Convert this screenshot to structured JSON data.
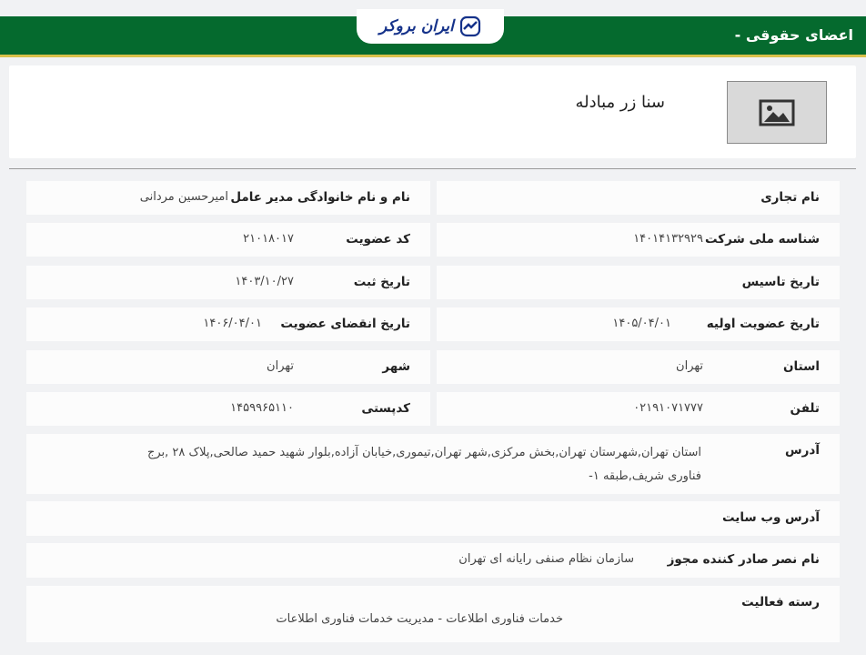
{
  "header": {
    "title": "اعضای حقوقی -",
    "logo_text": "ایران بروکر",
    "colors": {
      "header_bg": "#056a2e",
      "accent": "#d9c14a",
      "logo": "#15328a"
    }
  },
  "company": {
    "name": "سنا زر مبادله",
    "image_icon": "image-placeholder-icon"
  },
  "fields": {
    "trade_name": {
      "label": "نام تجاری",
      "value": ""
    },
    "ceo": {
      "label": "نام و نام خانوادگی مدیر عامل",
      "value": "امیرحسین مردانی"
    },
    "national_id": {
      "label": "شناسه ملی شرکت",
      "value": "۱۴۰۱۴۱۳۲۹۲۹"
    },
    "member_code": {
      "label": "کد عضویت",
      "value": "۲۱۰۱۸۰۱۷"
    },
    "founded": {
      "label": "تاریخ تاسیس",
      "value": ""
    },
    "registered": {
      "label": "تاریخ ثبت",
      "value": "۱۴۰۳/۱۰/۲۷"
    },
    "membership_start": {
      "label": "تاریخ عضویت اولیه",
      "value": "۱۴۰۵/۰۴/۰۱"
    },
    "membership_end": {
      "label": "تاریخ انقضای عضویت",
      "value": "۱۴۰۶/۰۴/۰۱"
    },
    "province": {
      "label": "استان",
      "value": "تهران"
    },
    "city": {
      "label": "شهر",
      "value": "تهران"
    },
    "phone": {
      "label": "تلفن",
      "value": "۰۲۱۹۱۰۷۱۷۷۷"
    },
    "postal": {
      "label": "کدپستی",
      "value": "۱۴۵۹۹۶۵۱۱۰"
    },
    "address": {
      "label": "آدرس",
      "value": "استان تهران,شهرستان تهران,بخش مرکزی,شهر تهران,تیموری,خیابان آزاده,بلوار شهید حمید صالحی,پلاک ۲۸ ,برج فناوری شریف,طبقه ۱-"
    },
    "website": {
      "label": "آدرس وب سایت",
      "value": ""
    },
    "license_issuer": {
      "label": "نام نصر صادر کننده مجوز",
      "value": "سازمان نظام صنفی رایانه ای تهران"
    },
    "activity": {
      "label": "رسته فعالیت",
      "value": "خدمات فناوری اطلاعات - مدیریت خدمات فناوری اطلاعات"
    }
  }
}
